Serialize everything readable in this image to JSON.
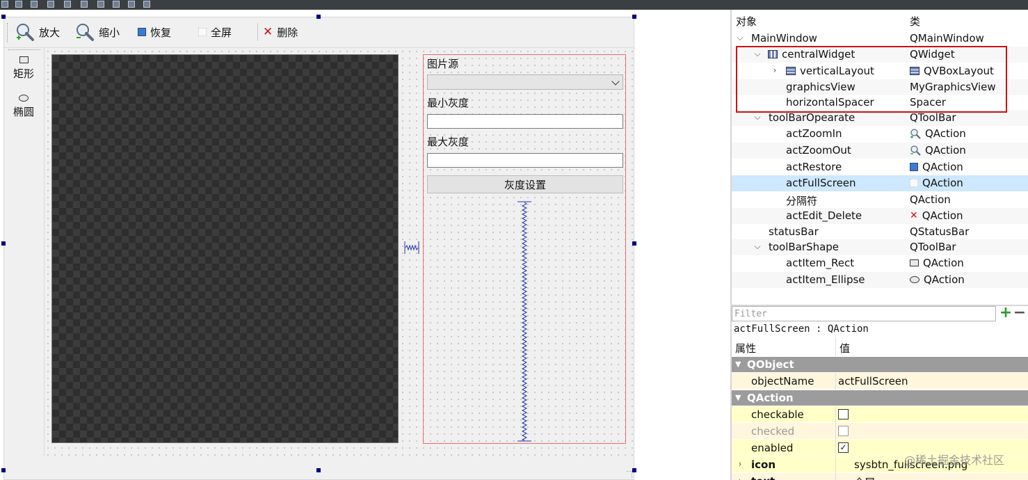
{
  "colors": {
    "selection": "#cde8ff",
    "group_header": "#9c9c9c",
    "highlight_box": "#d10f0f",
    "property_row": "#ffffc8",
    "property_row_alt": "#fff6dd",
    "canvas_dark": "#3c3c3c"
  },
  "form": {
    "toolbar_operate": [
      {
        "label": "放大",
        "icon": "zoom-in-icon"
      },
      {
        "label": "缩小",
        "icon": "zoom-out-icon"
      },
      {
        "label": "恢复",
        "icon": "restore-icon"
      },
      {
        "label": "全屏",
        "icon": "fullscreen-icon"
      },
      {
        "label": "删除",
        "icon": "delete-icon"
      }
    ],
    "toolbar_shape": [
      {
        "label": "矩形",
        "icon": "rectangle-icon"
      },
      {
        "label": "椭圆",
        "icon": "ellipse-icon"
      }
    ],
    "panel": {
      "image_source_label": "图片源",
      "image_source_value": "",
      "min_gray_label": "最小灰度",
      "min_gray_value": "",
      "max_gray_label": "最大灰度",
      "max_gray_value": "",
      "gray_button": "灰度设置"
    }
  },
  "object_inspector": {
    "headers": {
      "object": "对象",
      "class": "类"
    },
    "rows": [
      {
        "name": "MainWindow",
        "class": "QMainWindow",
        "icon": ""
      },
      {
        "name": "centralWidget",
        "class": "QWidget",
        "icon": "layout-icon"
      },
      {
        "name": "verticalLayout",
        "class": "QVBoxLayout",
        "icon": "vertical-layout-icon"
      },
      {
        "name": "graphicsView",
        "class": "MyGraphicsView",
        "icon": ""
      },
      {
        "name": "horizontalSpacer",
        "class": "Spacer",
        "icon": ""
      },
      {
        "name": "toolBarOpearate",
        "class": "QToolBar",
        "icon": ""
      },
      {
        "name": "actZoomIn",
        "class": "QAction",
        "icon": "zoom-in-icon"
      },
      {
        "name": "actZoomOut",
        "class": "QAction",
        "icon": "zoom-out-icon"
      },
      {
        "name": "actRestore",
        "class": "QAction",
        "icon": "restore-icon"
      },
      {
        "name": "actFullScreen",
        "class": "QAction",
        "icon": "fullscreen-icon"
      },
      {
        "name": "分隔符",
        "class": "QAction",
        "icon": ""
      },
      {
        "name": "actEdit_Delete",
        "class": "QAction",
        "icon": "delete-icon"
      },
      {
        "name": "statusBar",
        "class": "QStatusBar",
        "icon": ""
      },
      {
        "name": "toolBarShape",
        "class": "QToolBar",
        "icon": ""
      },
      {
        "name": "actItem_Rect",
        "class": "QAction",
        "icon": "rectangle-icon"
      },
      {
        "name": "actItem_Ellipse",
        "class": "QAction",
        "icon": "ellipse-icon"
      }
    ]
  },
  "property_editor": {
    "filter_placeholder": "Filter",
    "current": "actFullScreen : QAction",
    "headers": {
      "property": "属性",
      "value": "值"
    },
    "groups": [
      {
        "title": "QObject",
        "props": [
          {
            "key": "objectName",
            "value": "actFullScreen"
          }
        ]
      },
      {
        "title": "QAction",
        "props": [
          {
            "key": "checkable",
            "value": false
          },
          {
            "key": "checked",
            "value": false
          },
          {
            "key": "enabled",
            "value": true
          },
          {
            "key": "icon",
            "value": "sysbtn_fullscreen.png"
          },
          {
            "key": "text",
            "value": "全屏"
          }
        ]
      }
    ]
  },
  "watermark": "@稀土掘金技术社区"
}
